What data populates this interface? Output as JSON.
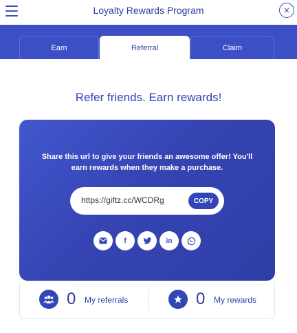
{
  "header": {
    "title": "Loyalty Rewards Program",
    "menu_icon": "hamburger-menu-icon",
    "close_icon": "close-icon",
    "close_glyph": "✕"
  },
  "tabs": [
    {
      "label": "Earn",
      "active": false
    },
    {
      "label": "Referral",
      "active": true
    },
    {
      "label": "Claim",
      "active": false
    }
  ],
  "referral": {
    "headline": "Refer friends. Earn rewards!",
    "share_text": "Share this url to give your friends an awesome offer! You'll earn rewards when they make a purchase.",
    "url": "https://giftz.cc/WCDRg",
    "copy_label": "COPY",
    "share_icons": [
      "email-icon",
      "facebook-icon",
      "twitter-icon",
      "linkedin-icon",
      "whatsapp-icon"
    ],
    "share_glyphs": {
      "facebook": "f",
      "linkedin": "in"
    }
  },
  "stats": {
    "referrals": {
      "value": "0",
      "label": "My referrals",
      "icon": "users-icon"
    },
    "rewards": {
      "value": "0",
      "label": "My rewards",
      "icon": "star-icon"
    }
  },
  "colors": {
    "primary": "#3d4fc4",
    "accent": "#3246b8",
    "text": "#2f3fa8"
  }
}
